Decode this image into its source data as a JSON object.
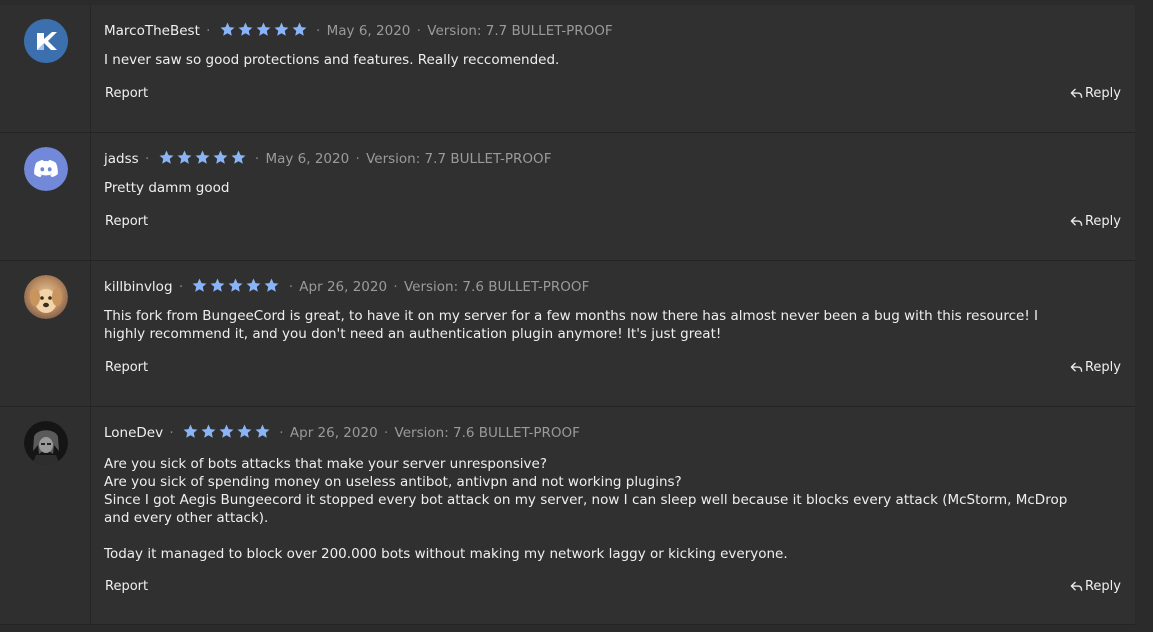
{
  "reviews": [
    {
      "username": "MarcoTheBest",
      "rating": 5,
      "date": "May 6, 2020",
      "version": "Version: 7.7 BULLET-PROOF",
      "text": "I never saw so good protections and features. Really reccomended.",
      "report_label": "Report",
      "reply_label": "Reply",
      "avatar": "brand-logo-avatar"
    },
    {
      "username": "jadss",
      "rating": 5,
      "date": "May 6, 2020",
      "version": "Version: 7.7 BULLET-PROOF",
      "text": "Pretty damm good",
      "report_label": "Report",
      "reply_label": "Reply",
      "avatar": "discord-avatar"
    },
    {
      "username": "killbinvlog",
      "rating": 5,
      "date": "Apr 26, 2020",
      "version": "Version: 7.6 BULLET-PROOF",
      "text": "This fork from BungeeCord is great, to have it on my server for a few months now there has almost never been a bug with this resource! I highly recommend it, and you don't need an authentication plugin anymore! It's just great!",
      "report_label": "Report",
      "reply_label": "Reply",
      "avatar": "dog-photo-avatar"
    },
    {
      "username": "LoneDev",
      "rating": 5,
      "date": "Apr 26, 2020",
      "version": "Version: 7.6 BULLET-PROOF",
      "text": "Are you sick of bots attacks that make your server unresponsive?\nAre you sick of spending money on useless antibot, antivpn and not working plugins?\nSince I got Aegis Bungeecord it stopped every bot attack on my server, now I can sleep well because it blocks every attack (McStorm, McDrop and every other attack).\n\nToday it managed to block over 200.000 bots without making my network laggy or kicking everyone.",
      "report_label": "Report",
      "reply_label": "Reply",
      "avatar": "dark-character-avatar"
    }
  ],
  "colors": {
    "star": "#8ab4f8",
    "background": "#2b2b2b",
    "card": "#303030",
    "muted": "#9a9a9a"
  }
}
